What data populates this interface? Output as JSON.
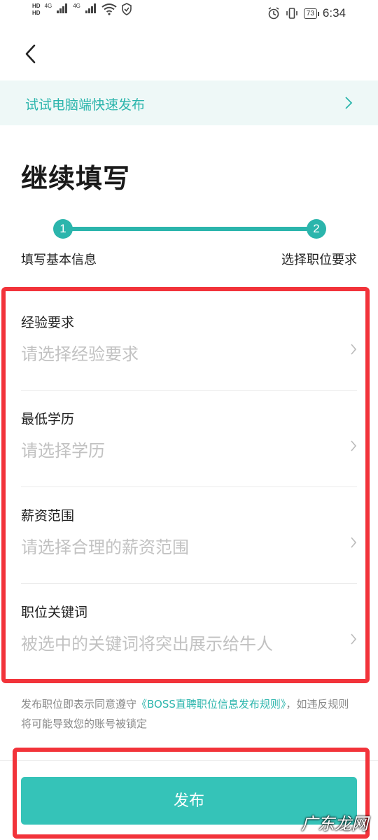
{
  "status_bar": {
    "hd1": "HD",
    "hd2": "HD",
    "signal1": "4G",
    "signal2": "4G",
    "battery": "73",
    "time": "6:34"
  },
  "banner": {
    "text": "试试电脑端快速发布"
  },
  "page": {
    "title": "继续填写"
  },
  "progress": {
    "steps": [
      {
        "number": "1",
        "label": "填写基本信息"
      },
      {
        "number": "2",
        "label": "选择职位要求"
      }
    ]
  },
  "form": {
    "fields": [
      {
        "label": "经验要求",
        "placeholder": "请选择经验要求"
      },
      {
        "label": "最低学历",
        "placeholder": "请选择学历"
      },
      {
        "label": "薪资范围",
        "placeholder": "请选择合理的薪资范围"
      },
      {
        "label": "职位关键词",
        "placeholder": "被选中的关键词将突出展示给牛人"
      }
    ]
  },
  "agreement": {
    "prefix": "发布职位即表示同意遵守",
    "link": "《BOSS直聘职位信息发布规则》",
    "suffix": "，如违反规则将可能导致您的账号被锁定"
  },
  "publish_button": {
    "label": "发布"
  },
  "watermark": "广东龙网",
  "colors": {
    "accent": "#2bb5ac",
    "button": "#35c3b8",
    "highlight": "#f2333a"
  }
}
